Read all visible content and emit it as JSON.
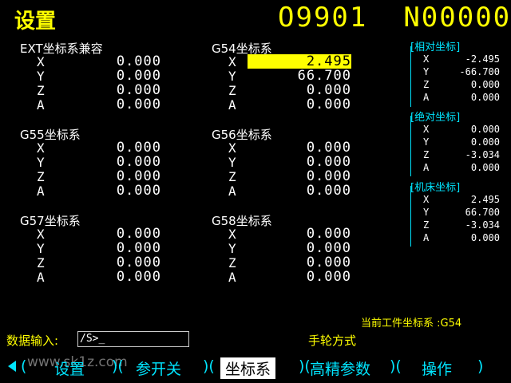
{
  "header": {
    "title": "设置",
    "program": "O9901",
    "sequence": "N00000"
  },
  "groups": {
    "ext": {
      "title": "EXT坐标系兼容",
      "x": "0.000",
      "y": "0.000",
      "z": "0.000",
      "a": "0.000"
    },
    "g54": {
      "title": "G54坐标系",
      "x": "2.495",
      "y": "66.700",
      "z": "0.000",
      "a": "0.000"
    },
    "g55": {
      "title": "G55坐标系",
      "x": "0.000",
      "y": "0.000",
      "z": "0.000",
      "a": "0.000"
    },
    "g56": {
      "title": "G56坐标系",
      "x": "0.000",
      "y": "0.000",
      "z": "0.000",
      "a": "0.000"
    },
    "g57": {
      "title": "G57坐标系",
      "x": "0.000",
      "y": "0.000",
      "z": "0.000",
      "a": "0.000"
    },
    "g58": {
      "title": "G58坐标系",
      "x": "0.000",
      "y": "0.000",
      "z": "0.000",
      "a": "0.000"
    }
  },
  "axes": {
    "x": "X",
    "y": "Y",
    "z": "Z",
    "a": "A"
  },
  "right_panel": {
    "relative": {
      "title": "[相对坐标]",
      "x": "-2.495",
      "y": "-66.700",
      "z": "0.000",
      "a": "0.000"
    },
    "absolute": {
      "title": "[绝对坐标]",
      "x": "0.000",
      "y": "0.000",
      "z": "-3.034",
      "a": "0.000"
    },
    "machine": {
      "title": "[机床坐标]",
      "x": "2.495",
      "y": "66.700",
      "z": "-3.034",
      "a": "0.000"
    }
  },
  "status": {
    "current_wcs": "当前工件坐标系 :G54"
  },
  "input": {
    "label": "数据输入:",
    "value": "/S>_"
  },
  "mode": "手轮方式",
  "softkeys": [
    "设置",
    "参开关",
    "坐标系",
    "高精参数",
    "操作"
  ],
  "watermark": "www.sk1z.com",
  "colors": {
    "accent": "#ffff00",
    "cyan": "#00e5ff",
    "highlight": "#ffff00",
    "background": "#000000"
  }
}
